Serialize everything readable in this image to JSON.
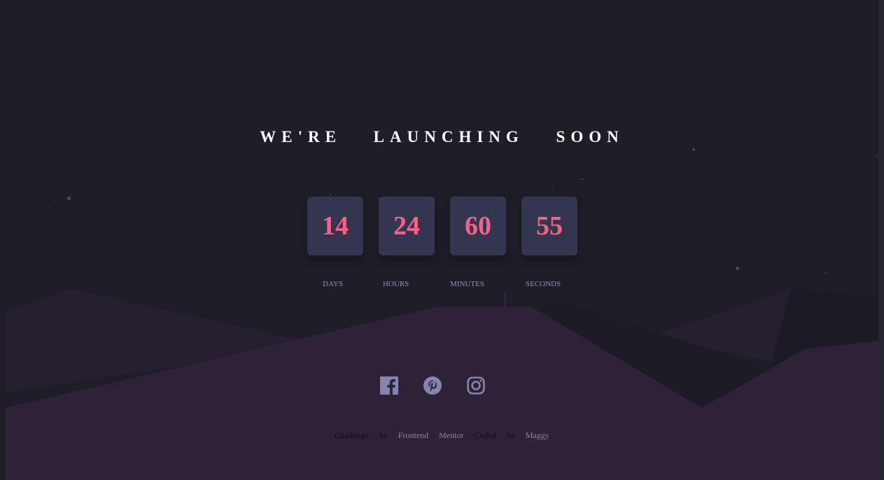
{
  "title": "WE'RE LAUNCHING SOON",
  "countdown": [
    {
      "value": "14",
      "label": "DAYS"
    },
    {
      "value": "24",
      "label": "HOURS"
    },
    {
      "value": "60",
      "label": "MINUTES"
    },
    {
      "value": "55",
      "label": "SECONDS"
    }
  ],
  "social": [
    {
      "icon": "facebook-icon"
    },
    {
      "icon": "pinterest-icon"
    },
    {
      "icon": "instagram-icon"
    }
  ],
  "credits": {
    "prefix": "Challenge by",
    "link1": "Frontend Mentor",
    "middle": "Coded by",
    "link2": "Maggy"
  },
  "colors": {
    "background": "#1f1e28",
    "card": "#343650",
    "number": "#fb6087",
    "label": "#8f8fb3",
    "hill": "#2e2239",
    "icon": "#8585ad"
  }
}
